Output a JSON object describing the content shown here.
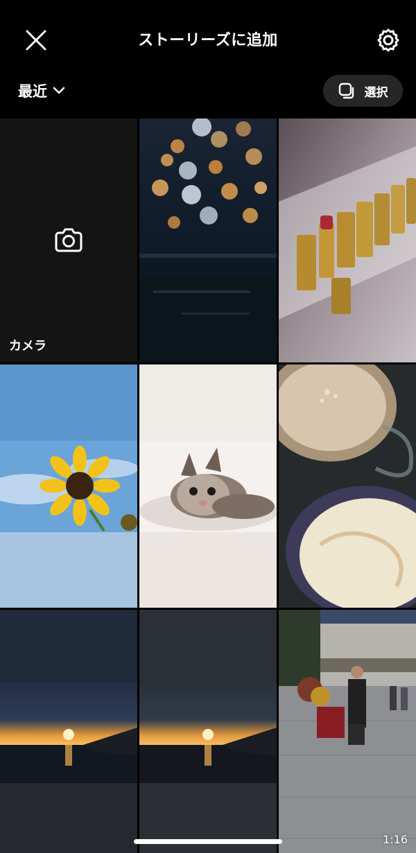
{
  "header": {
    "title": "ストーリーズに追加",
    "close_icon": "close-icon",
    "settings_icon": "gear-icon"
  },
  "filter": {
    "album_label": "最近",
    "select_label": "選択"
  },
  "grid": {
    "camera_label": "カメラ",
    "video_duration": "1:16"
  },
  "colors": {
    "background": "#000000",
    "tile_dark": "#141414",
    "button_bg": "#262626"
  }
}
